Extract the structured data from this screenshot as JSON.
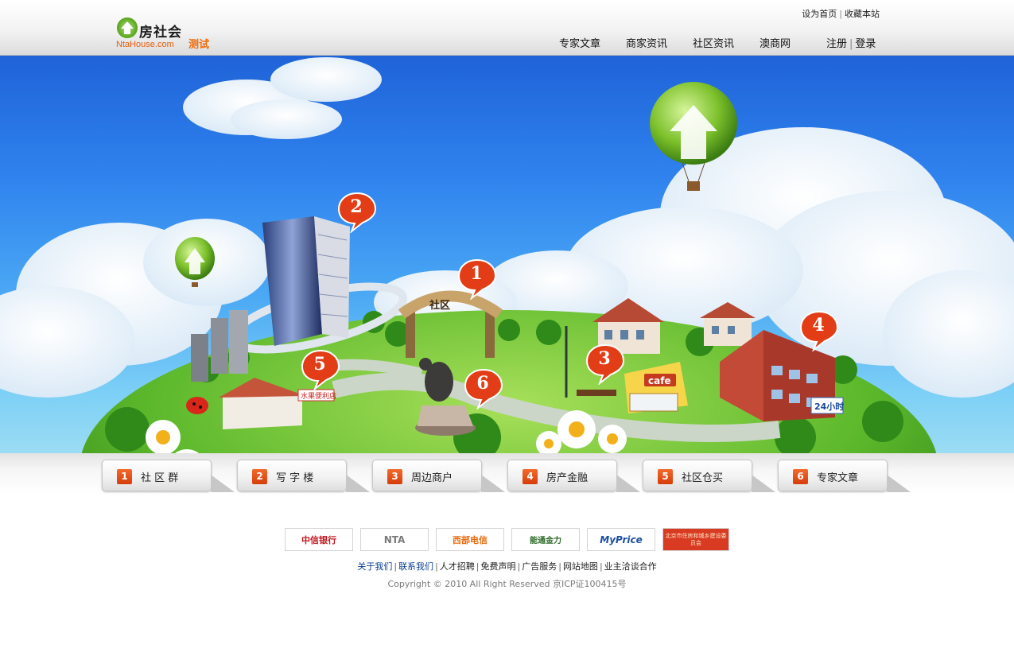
{
  "header": {
    "logo_title": "房社会",
    "logo_domain": "NtaHouse.com",
    "logo_tag": "测试",
    "top_links": [
      "设为首页",
      "收藏本站"
    ],
    "nav": [
      "专家文章",
      "商家资讯",
      "社区资讯",
      "澳商网"
    ],
    "auth": [
      "注册",
      "登录"
    ]
  },
  "hero": {
    "arch_sign": "社区",
    "cafe_sign": "cafe",
    "store_sign": "水果便利店",
    "clinic_sign": "24小时",
    "pins": [
      "1",
      "2",
      "3",
      "4",
      "5",
      "6"
    ]
  },
  "tabs": [
    {
      "num": "1",
      "label": "社 区 群"
    },
    {
      "num": "2",
      "label": "写 字 楼"
    },
    {
      "num": "3",
      "label": "周边商户"
    },
    {
      "num": "4",
      "label": "房产金融"
    },
    {
      "num": "5",
      "label": "社区仓买"
    },
    {
      "num": "6",
      "label": "专家文章"
    }
  ],
  "partners": [
    "中信银行",
    "NTA",
    "西部电信",
    "能通金力",
    "MyPrice",
    "北京市住房和城乡建设委员会"
  ],
  "footer_links": [
    "关于我们",
    "联系我们",
    "人才招聘",
    "免费声明",
    "广告服务",
    "网站地图",
    "业主洽谈合作"
  ],
  "copyright": "Copyright © 2010 All Right Reserved 京ICP证100415号",
  "colors": {
    "accent": "#f26b0a",
    "tab_number": "#e54e16",
    "link_blue": "#0b3d91"
  }
}
